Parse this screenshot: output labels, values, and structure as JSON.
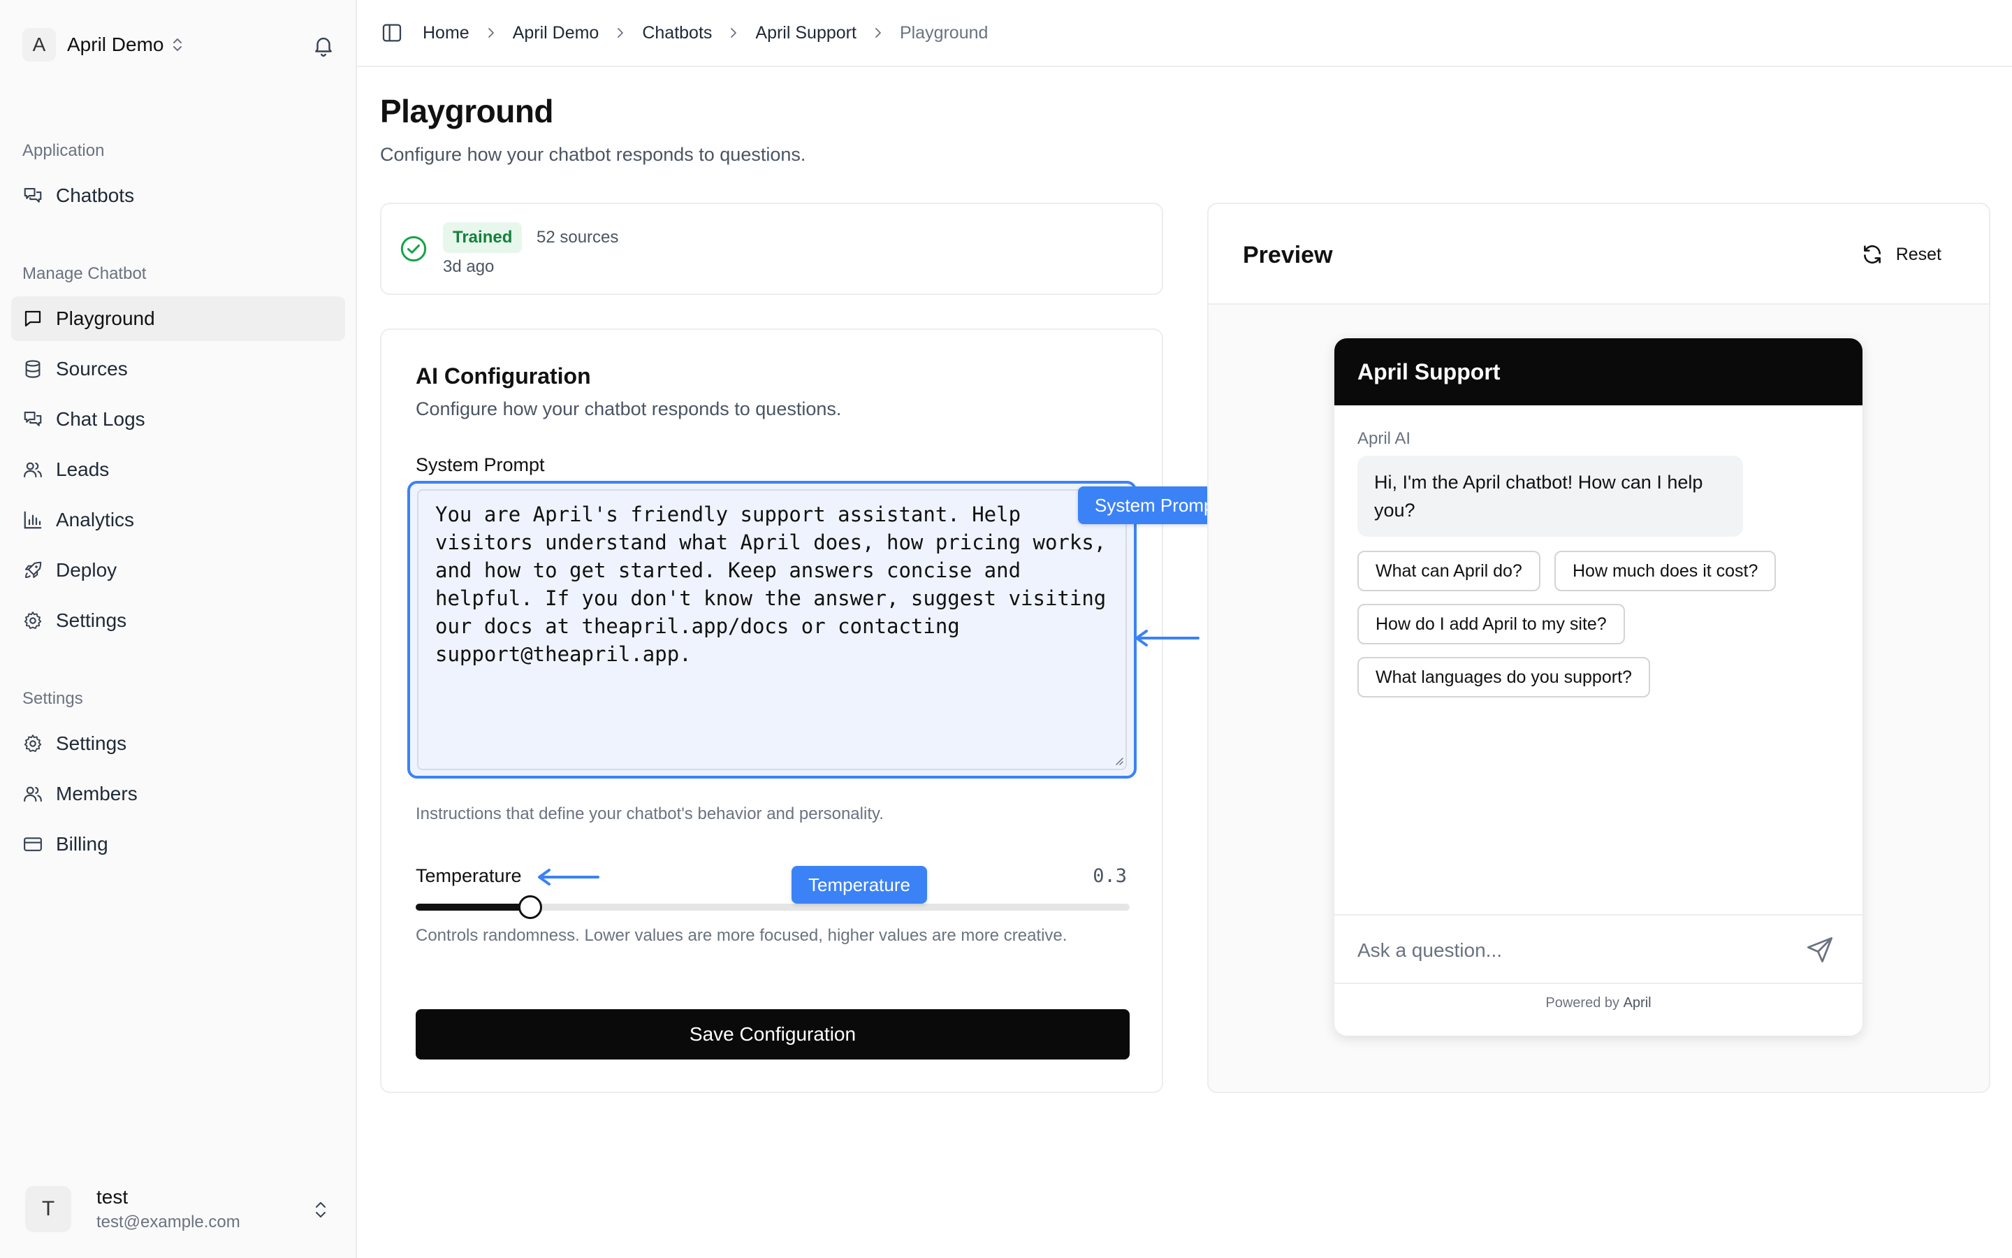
{
  "workspace": {
    "initial": "A",
    "name": "April Demo"
  },
  "sidebar": {
    "sections": [
      {
        "label": "Application",
        "items": [
          {
            "label": "Chatbots",
            "icon": "chats-icon"
          }
        ]
      },
      {
        "label": "Manage Chatbot",
        "items": [
          {
            "label": "Playground",
            "icon": "message-square-icon",
            "active": true
          },
          {
            "label": "Sources",
            "icon": "database-icon"
          },
          {
            "label": "Chat Logs",
            "icon": "chats-icon"
          },
          {
            "label": "Leads",
            "icon": "users-icon"
          },
          {
            "label": "Analytics",
            "icon": "bar-chart-icon"
          },
          {
            "label": "Deploy",
            "icon": "rocket-icon"
          },
          {
            "label": "Settings",
            "icon": "gear-icon"
          }
        ]
      },
      {
        "label": "Settings",
        "items": [
          {
            "label": "Settings",
            "icon": "gear-icon"
          },
          {
            "label": "Members",
            "icon": "users-icon"
          },
          {
            "label": "Billing",
            "icon": "credit-card-icon"
          }
        ]
      }
    ]
  },
  "user": {
    "initial": "T",
    "name": "test",
    "email": "test@example.com"
  },
  "breadcrumb": [
    "Home",
    "April Demo",
    "Chatbots",
    "April Support",
    "Playground"
  ],
  "page": {
    "title": "Playground",
    "subtitle": "Configure how your chatbot responds to questions."
  },
  "status": {
    "badge": "Trained",
    "sources": "52 sources",
    "ago": "3d ago"
  },
  "config": {
    "title": "AI Configuration",
    "subtitle": "Configure how your chatbot responds to questions.",
    "system_prompt_label": "System Prompt",
    "system_prompt_value": "You are April's friendly support assistant. Help visitors understand what April does, how pricing works, and how to get started. Keep answers concise and helpful. If you don't know the answer, suggest visiting our docs at theapril.app/docs or contacting support@theapril.app.",
    "system_prompt_help": "Instructions that define your chatbot's behavior and personality.",
    "temperature_label": "Temperature",
    "temperature_value": "0.3",
    "temperature_fraction": 0.16,
    "temperature_help": "Controls randomness. Lower values are more focused, higher values are more creative.",
    "save_label": "Save Configuration"
  },
  "annotations": {
    "system_prompt_tag": "System Prompt",
    "temperature_tag": "Temperature",
    "color": "#3b82f6"
  },
  "preview": {
    "title": "Preview",
    "reset_label": "Reset",
    "widget_title": "April Support",
    "bot_name": "April AI",
    "greeting": "Hi, I'm the April chatbot! How can I help you?",
    "suggestions": [
      "What can April do?",
      "How much does it cost?",
      "How do I add April to my site?",
      "What languages do you support?"
    ],
    "input_placeholder": "Ask a question...",
    "powered_prefix": "Powered by",
    "powered_brand": "April"
  }
}
